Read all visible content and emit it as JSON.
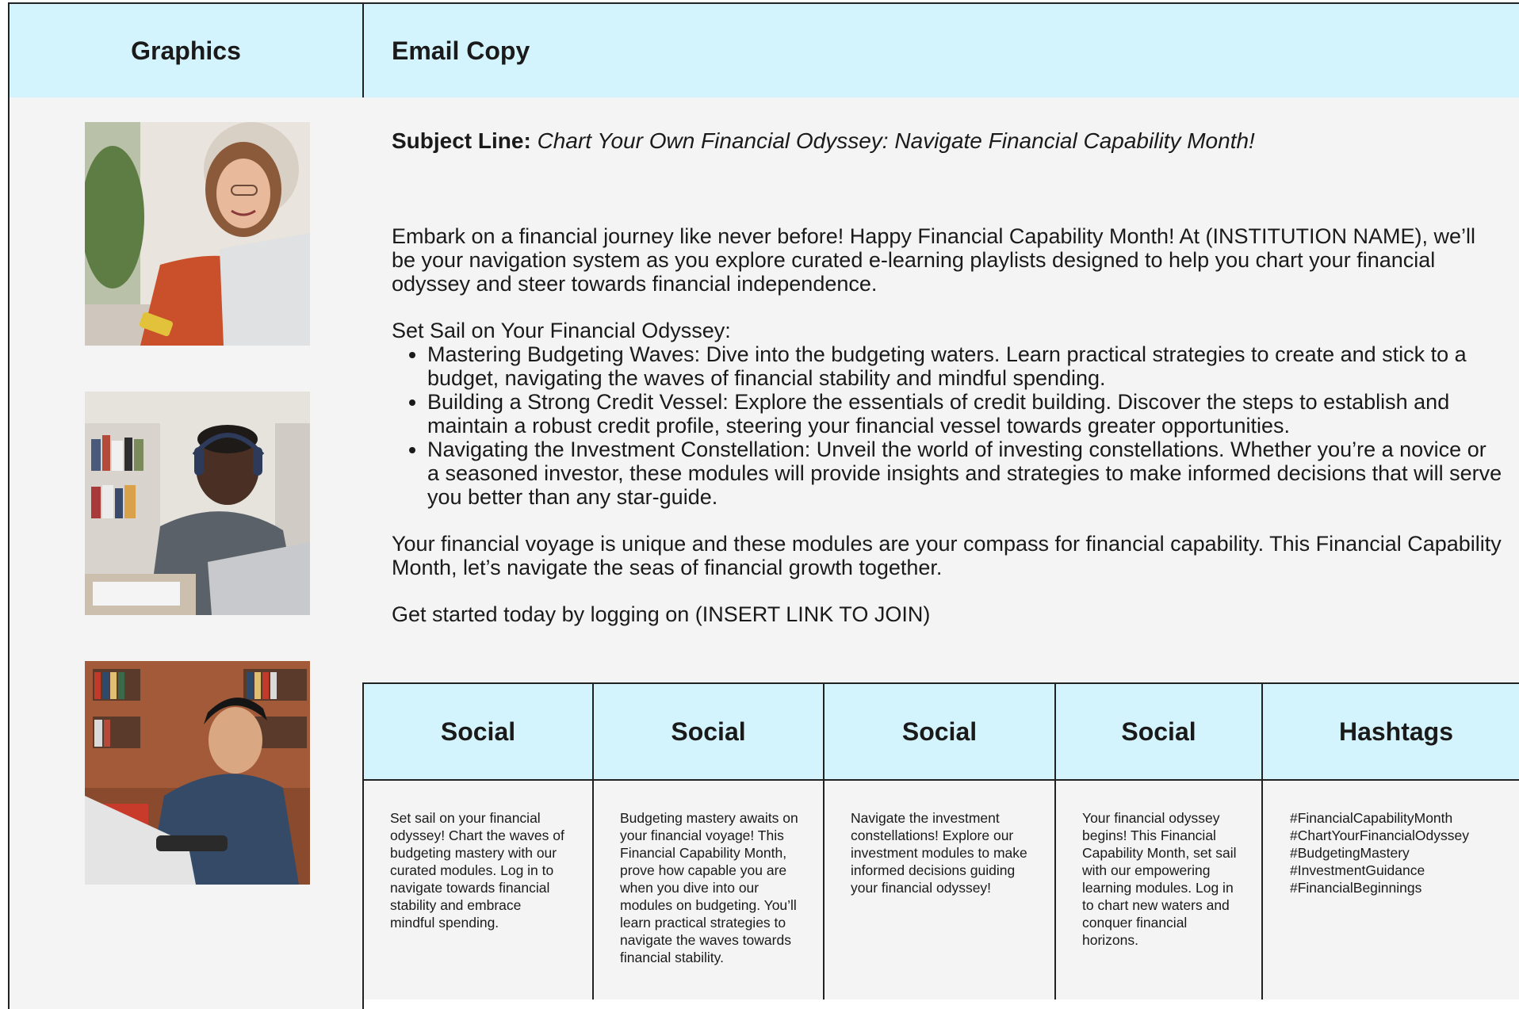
{
  "headers": {
    "graphics": "Graphics",
    "email_copy": "Email Copy"
  },
  "email": {
    "subject_label": "Subject Line:",
    "subject_text": "Chart Your Own Financial Odyssey: Navigate Financial Capability Month!",
    "intro": "Embark on a financial journey like never before! Happy Financial Capability Month! At (INSTITUTION NAME), we’ll be your navigation system as you explore curated e-learning playlists designed to help you chart your financial odyssey and steer towards financial independence.",
    "list_heading": "Set Sail on Your Financial Odyssey:",
    "bullets": [
      "Mastering Budgeting Waves: Dive into the budgeting waters. Learn practical strategies to create and stick to a budget, navigating the waves of financial stability and mindful spending.",
      "Building a Strong Credit Vessel: Explore the essentials of credit building. Discover the steps to establish and maintain a robust credit profile, steering your financial vessel towards greater opportunities.",
      "Navigating the Investment Constellation: Unveil the world of investing constellations.  Whether you’re a novice or a seasoned investor, these modules will provide insights and strategies to make informed decisions that will serve you better than any star-guide."
    ],
    "closing": "Your financial voyage is unique and these modules are your compass for financial capability.  This Financial Capability Month, let’s navigate the seas of financial growth together.",
    "cta": "Get started today by logging on (INSERT LINK TO JOIN)"
  },
  "social": [
    {
      "header": "Social",
      "text": "Set sail on your financial odyssey! Chart the waves of budgeting mastery with our curated modules. Log in to navigate towards financial stability and embrace mindful spending."
    },
    {
      "header": "Social",
      "text": "Budgeting mastery awaits on your financial voyage! This Financial Capability Month, prove how capable you are when you dive into our modules on budgeting. You’ll learn practical strategies to navigate the waves towards financial stability."
    },
    {
      "header": "Social",
      "text": "Navigate the investment constellations! Explore our investment modules to make informed decisions guiding your financial odyssey!"
    },
    {
      "header": "Social",
      "text": "Your financial odyssey begins! This Financial Capability Month, set sail with our empowering learning modules.  Log in to chart new waters and conquer financial horizons."
    }
  ],
  "hashtags": {
    "header": "Hashtags",
    "tags": [
      "#FinancialCapabilityMonth",
      "#ChartYourFinancialOdyssey",
      "#BudgetingMastery",
      "#InvestmentGuidance",
      "#FinancialBeginnings"
    ]
  },
  "colors": {
    "header_bg": "#d4f4fd",
    "body_bg": "#f4f4f4",
    "border": "#222222"
  }
}
